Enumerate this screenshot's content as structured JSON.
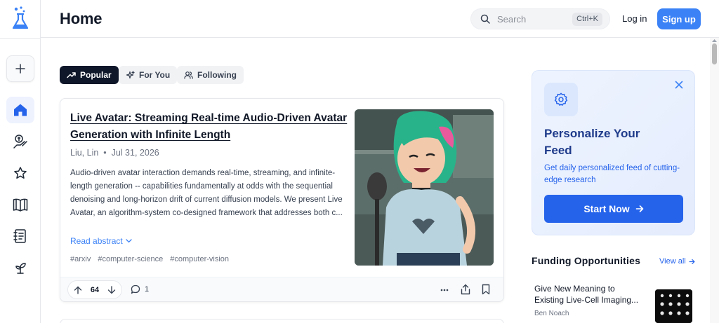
{
  "header": {
    "title": "Home",
    "search_placeholder": "Search",
    "search_shortcut": "Ctrl+K",
    "login_label": "Log in",
    "signup_label": "Sign up"
  },
  "sidebar": {
    "items": [
      {
        "icon": "plus-icon",
        "label": "New"
      },
      {
        "icon": "home-icon",
        "label": "Home",
        "active": true
      },
      {
        "icon": "hand-coin-icon",
        "label": "Funding"
      },
      {
        "icon": "star-icon",
        "label": "Favorites"
      },
      {
        "icon": "book-open-icon",
        "label": "Library"
      },
      {
        "icon": "notebook-icon",
        "label": "Notes"
      },
      {
        "icon": "sprout-icon",
        "label": "Grow"
      }
    ]
  },
  "tabs": [
    {
      "label": "Popular",
      "icon": "trending-icon",
      "active": true
    },
    {
      "label": "For You",
      "icon": "sparkles-icon",
      "active": false
    },
    {
      "label": "Following",
      "icon": "users-icon",
      "active": false
    }
  ],
  "paper": {
    "title": "Live Avatar: Streaming Real-time Audio-Driven Avatar Generation with Infinite Length",
    "author": "Liu, Lin",
    "date": "Jul 31, 2026",
    "abstract": "Audio-driven avatar interaction demands real-time, streaming, and infinite-length generation -- capabilities fundamentally at odds with the sequential denoising and long-horizon drift of current diffusion models. We present Live Avatar, an algorithm-system co-designed framework that addresses both c...",
    "read_abstract_label": "Read abstract",
    "tags": [
      "#arxiv",
      "#computer-science",
      "#computer-vision"
    ],
    "votes": "64",
    "comments": "1"
  },
  "promo": {
    "title": "Personalize Your Feed",
    "text": "Get daily personalized feed of cutting-edge research",
    "button_label": "Start Now"
  },
  "funding": {
    "title": "Funding Opportunities",
    "view_all_label": "View all",
    "items": [
      {
        "title": "Give New Meaning to Existing Live-Cell Imaging...",
        "author": "Ben Noach"
      }
    ]
  },
  "colors": {
    "accent": "#3b82f6",
    "dark_tab": "#0f172a",
    "promo_title": "#1e3a8a"
  }
}
